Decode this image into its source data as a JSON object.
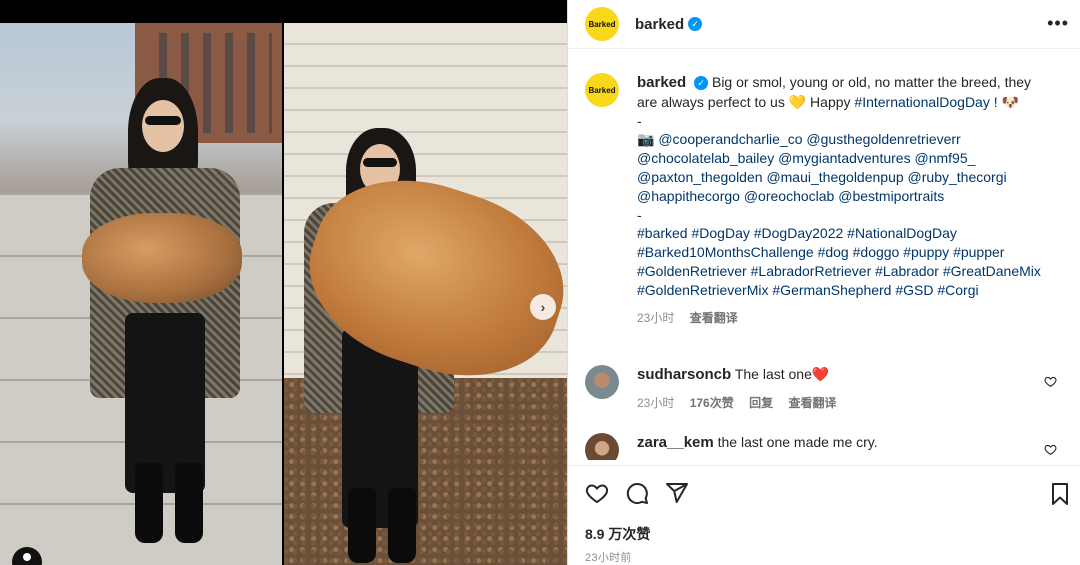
{
  "post": {
    "author": "barked",
    "avatar_text": "Barked",
    "verified": true
  },
  "caption": {
    "author": "barked",
    "line1": "Big or smol, young or old, no matter the breed, they are always perfect to us 💛  Happy ",
    "hashtag_intl": "#InternationalDogDay",
    "line1_end": " ! 🐶",
    "dash1": "-",
    "camera": "📷",
    "mentions": [
      "@cooperandcharlie_co",
      "@gusthegoldenretrieverr",
      "@chocolatelab_bailey",
      "@mygiantadventures",
      "@nmf95_",
      "@paxton_thegolden",
      "@maui_thegoldenpup",
      "@ruby_thecorgi",
      "@happithecorgo",
      "@oreochoclab",
      "@bestmiportraits"
    ],
    "dash2": "-",
    "hashtags": [
      "#barked",
      "#DogDay",
      "#DogDay2022",
      "#NationalDogDay",
      "#Barked10MonthsChallenge",
      "#dog",
      "#doggo",
      "#puppy",
      "#pupper",
      "#GoldenRetriever",
      "#LabradorRetriever",
      "#Labrador",
      "#GreatDaneMix",
      "#GoldenRetrieverMix",
      "#GermanShepherd",
      "#GSD",
      "#Corgi"
    ],
    "time": "23小时",
    "see_translation": "查看翻译"
  },
  "comments": [
    {
      "user": "sudharsoncb",
      "text": "The last one",
      "emoji": "❤️",
      "time": "23小时",
      "likes": "176次赞",
      "reply": "回复",
      "see_translation": "查看翻译"
    },
    {
      "user": "zara__kem",
      "text": "the last one made me cry."
    }
  ],
  "footer": {
    "likes": "8.9 万次赞",
    "time_ago": "23小时前"
  },
  "icons": {
    "more": "more-options-icon",
    "like": "heart-icon",
    "comment": "comment-icon",
    "share": "paper-plane-icon",
    "save": "bookmark-icon",
    "next": "chevron-right-icon"
  }
}
